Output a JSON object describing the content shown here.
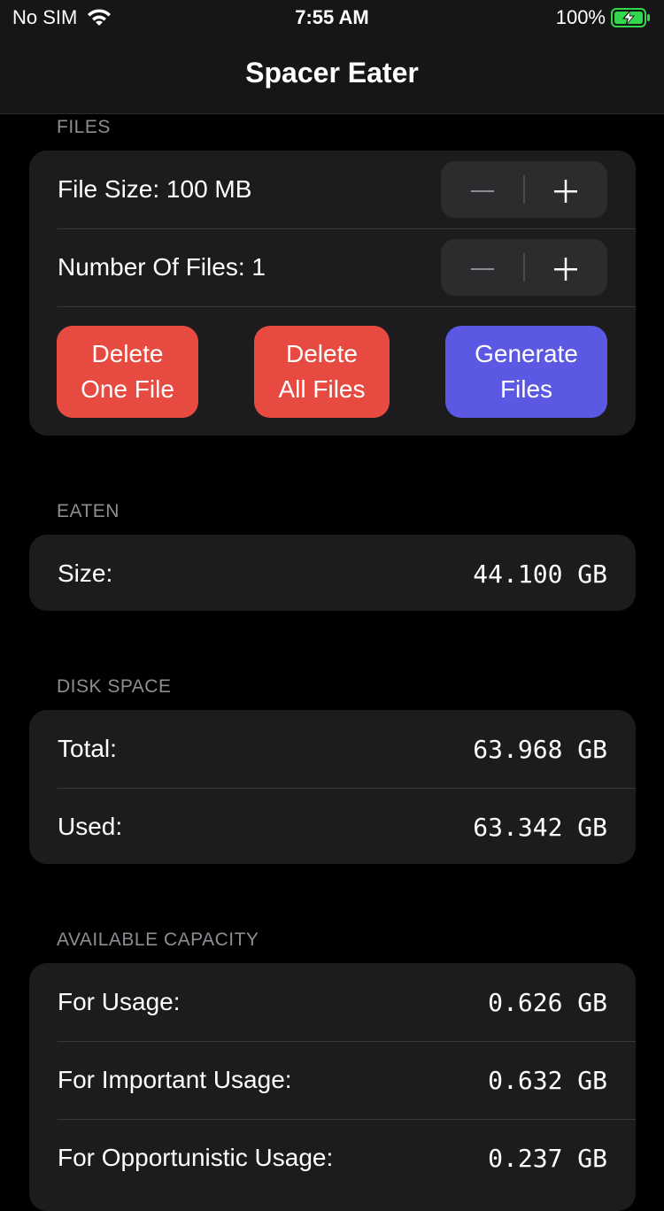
{
  "status_bar": {
    "carrier": "No SIM",
    "time": "7:55 AM",
    "battery": "100%",
    "wifi_icon": "wifi-icon",
    "battery_icon": "battery-charging-icon",
    "battery_color": "#32d74b"
  },
  "nav": {
    "title": "Spacer Eater"
  },
  "files": {
    "header": "FILES",
    "file_size_label": "File Size: 100 MB",
    "number_of_files_label": "Number Of Files: 1",
    "minus_icon": "minus-icon",
    "plus_icon": "plus-icon",
    "delete_one_line1": "Delete",
    "delete_one_line2": "One File",
    "delete_all_line1": "Delete",
    "delete_all_line2": "All Files",
    "generate_line1": "Generate",
    "generate_line2": "Files",
    "delete_color": "#e74a40",
    "generate_color": "#5b58e3"
  },
  "eaten": {
    "header": "EATEN",
    "size_label": "Size:",
    "size_value": "44.100 GB"
  },
  "disk_space": {
    "header": "DISK SPACE",
    "total_label": "Total:",
    "total_value": "63.968 GB",
    "used_label": "Used:",
    "used_value": "63.342 GB"
  },
  "available_capacity": {
    "header": "AVAILABLE CAPACITY",
    "usage_label": "For Usage:",
    "usage_value": "0.626 GB",
    "important_label": "For Important Usage:",
    "important_value": "0.632 GB",
    "opportunistic_label": "For Opportunistic Usage:",
    "opportunistic_value": "0.237 GB"
  }
}
